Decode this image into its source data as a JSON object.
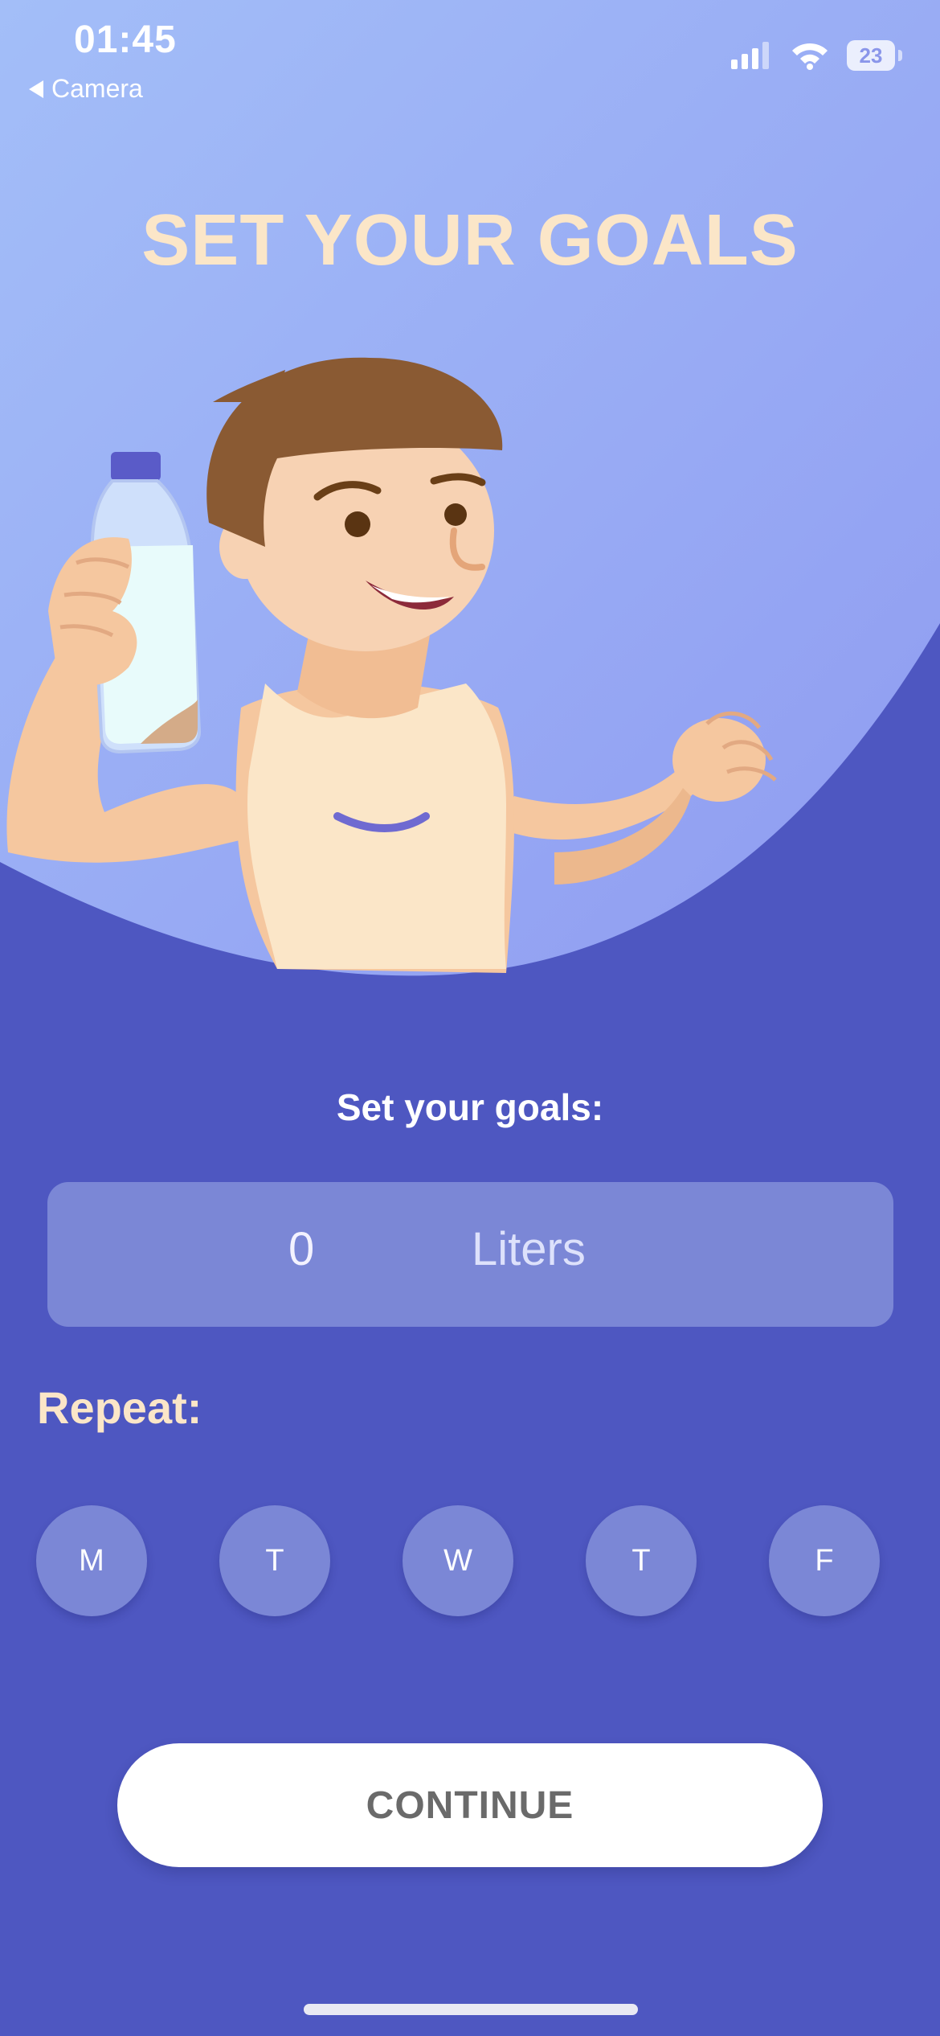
{
  "status_bar": {
    "time": "01:45",
    "back_label": "Camera",
    "battery": "23",
    "icons": [
      "cellular-signal-icon",
      "wifi-icon",
      "battery-icon"
    ]
  },
  "title": "SET YOUR GOALS",
  "goals": {
    "label": "Set your goals:",
    "value": "0",
    "unit": "Liters"
  },
  "repeat": {
    "label": "Repeat:",
    "days": [
      "M",
      "T",
      "W",
      "T",
      "F"
    ]
  },
  "continue_label": "CONTINUE",
  "colors": {
    "background": "#4e57c1",
    "hero_top_left": "#a3bef8",
    "hero_bottom_right": "#8f9bf1",
    "accent_cream": "#fbe6c8",
    "control_fill": "#7b87d6"
  }
}
